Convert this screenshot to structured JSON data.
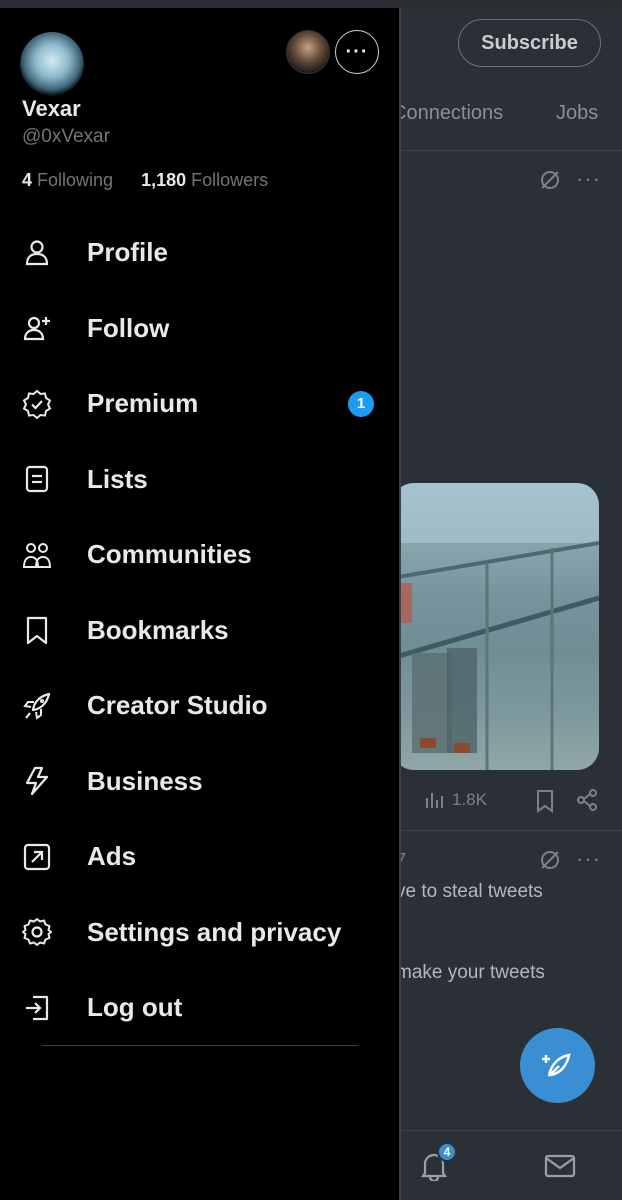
{
  "background": {
    "subscribe_label": "Subscribe",
    "tabs": [
      "Connections",
      "Jobs"
    ],
    "post1_views": "1.8K",
    "post2_fragment": "7",
    "post2_line1": "ve to steal tweets",
    "post2_line2": "make your tweets",
    "notification_count": "4"
  },
  "profile": {
    "display_name": "Vexar",
    "handle": "@0xVexar",
    "following_count": "4",
    "following_label": "Following",
    "followers_count": "1,180",
    "followers_label": "Followers",
    "more_label": "···"
  },
  "menu": {
    "items": [
      {
        "label": "Profile",
        "icon": "person-icon"
      },
      {
        "label": "Follow",
        "icon": "person-plus-icon"
      },
      {
        "label": "Premium",
        "icon": "verified-badge-icon",
        "badge": "1"
      },
      {
        "label": "Lists",
        "icon": "list-icon"
      },
      {
        "label": "Communities",
        "icon": "communities-icon"
      },
      {
        "label": "Bookmarks",
        "icon": "bookmark-icon"
      },
      {
        "label": "Creator Studio",
        "icon": "rocket-icon"
      },
      {
        "label": "Business",
        "icon": "lightning-icon"
      },
      {
        "label": "Ads",
        "icon": "ads-arrow-icon"
      },
      {
        "label": "Settings and privacy",
        "icon": "gear-icon"
      },
      {
        "label": "Log out",
        "icon": "logout-icon"
      }
    ]
  },
  "colors": {
    "drawer_bg": "#000000",
    "accent": "#1d9bf0",
    "text_primary": "#e7e9ea",
    "text_secondary": "#71767b"
  }
}
